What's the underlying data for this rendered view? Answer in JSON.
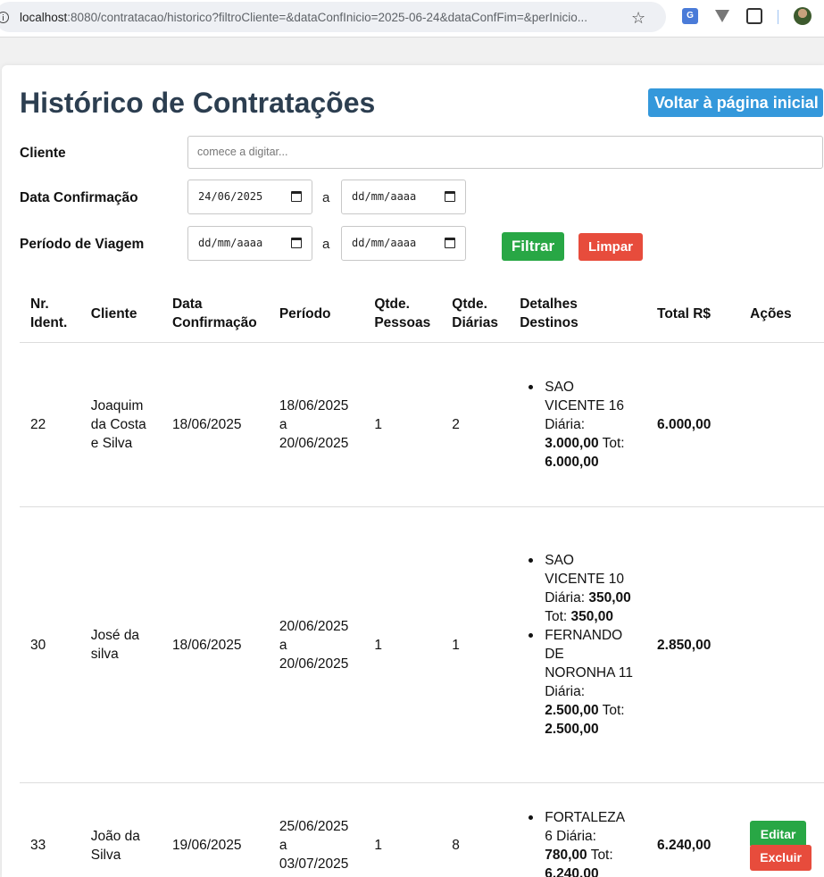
{
  "browser": {
    "url_host": "localhost",
    "url_rest": ":8080/contratacao/historico?filtroCliente=&dataConfInicio=2025-06-24&dataConfFim=&perInicio..."
  },
  "header": {
    "title": "Histórico de Contratações",
    "home_button": "Voltar à página inicial"
  },
  "filters": {
    "client_label": "Cliente",
    "client_placeholder": "comece a digitar...",
    "confirmation_label": "Data Confirmação",
    "confirmation_start": "24/06/2025",
    "confirmation_end": "dd/mm/aaaa",
    "trip_label": "Período de Viagem",
    "trip_start": "dd/mm/aaaa",
    "trip_end": "dd/mm/aaaa",
    "separator": "a",
    "filter_button": "Filtrar",
    "clear_button": "Limpar"
  },
  "table": {
    "headers": {
      "id_1": "Nr.",
      "id_2": "Ident.",
      "client": "Cliente",
      "date_1": "Data",
      "date_2": "Confirmação",
      "period": "Período",
      "people_1": "Qtde.",
      "people_2": "Pessoas",
      "days_1": "Qtde.",
      "days_2": "Diárias",
      "details_1": "Detalhes",
      "details_2": "Destinos",
      "total": "Total R$",
      "actions": "Ações"
    },
    "rows": [
      {
        "id": "22",
        "client": "Joaquim da Costa e Silva",
        "confirmation": "18/06/2025",
        "period_start": "18/06/2025",
        "period_sep": "a",
        "period_end": "20/06/2025",
        "people": "1",
        "days": "2",
        "destinations": [
          {
            "name": "SAO VICENTE 16",
            "daily_label": "Diária:",
            "daily": "3.000,00",
            "total_label": "Tot:",
            "total": "6.000,00"
          }
        ],
        "total": "6.000,00"
      },
      {
        "id": "30",
        "client": "José da silva",
        "confirmation": "18/06/2025",
        "period_start": "20/06/2025",
        "period_sep": "a",
        "period_end": "20/06/2025",
        "people": "1",
        "days": "1",
        "destinations": [
          {
            "name": "SAO VICENTE 10",
            "daily_label": "Diária:",
            "daily": "350,00",
            "total_label": "Tot:",
            "total": "350,00"
          },
          {
            "name": "FERNANDO DE NORONHA 11",
            "daily_label": "Diária:",
            "daily": "2.500,00",
            "total_label": "Tot:",
            "total": "2.500,00"
          }
        ],
        "total": "2.850,00"
      },
      {
        "id": "33",
        "client": "João da Silva",
        "confirmation": "19/06/2025",
        "period_start": "25/06/2025",
        "period_sep": "a",
        "period_end": "03/07/2025",
        "people": "1",
        "days": "8",
        "destinations": [
          {
            "name": "FORTALEZA 6",
            "daily_label": "Diária:",
            "daily": "780,00",
            "total_label": "Tot:",
            "total": "6.240,00"
          }
        ],
        "total": "6.240,00",
        "edit_button": "Editar",
        "delete_button": "Excluir"
      }
    ]
  },
  "icons": [
    "info-icon",
    "star-icon",
    "translate-icon",
    "extension-icon",
    "puzzle-icon",
    "avatar",
    "calendar-icon"
  ]
}
